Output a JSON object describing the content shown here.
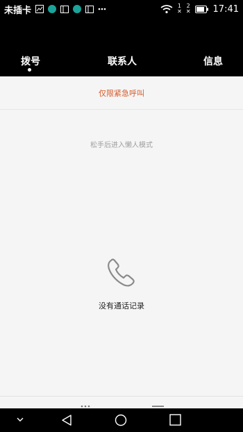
{
  "status_bar": {
    "carrier": "未插卡",
    "time": "17:41",
    "sim1_label": "1",
    "sim2_label": "2"
  },
  "tabs": [
    {
      "label": "拨号",
      "active": true
    },
    {
      "label": "联系人",
      "active": false
    },
    {
      "label": "信息",
      "active": false
    }
  ],
  "emergency_label": "仅限紧急呼叫",
  "lazy_mode_hint": "松手后进入懒人模式",
  "empty_state": {
    "text": "没有通话记录",
    "icon": "phone-handset-icon"
  },
  "colors": {
    "header_bg": "#000000",
    "emergency_text": "#d65a2a",
    "background": "#f5f5f5",
    "app_icon": "#1aa39a"
  }
}
